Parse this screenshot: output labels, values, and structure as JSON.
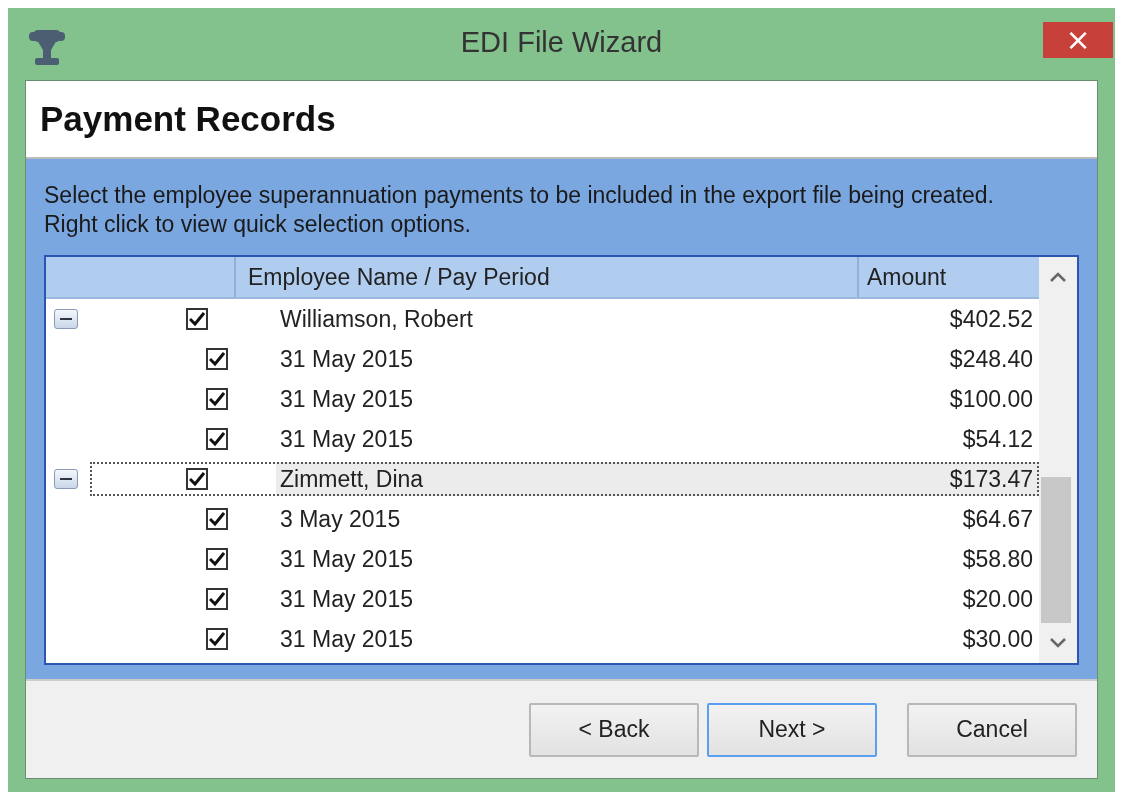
{
  "window": {
    "title": "EDI File Wizard",
    "close": "×"
  },
  "header": {
    "title": "Payment Records"
  },
  "instructions": "Select the employee superannuation payments to be included in the export file being created. Right click to view quick selection options.",
  "tree": {
    "columns": [
      "Employee Name / Pay Period",
      "Amount"
    ],
    "groups": [
      {
        "name": "Williamson, Robert",
        "amount": "$402.52",
        "expanded": true,
        "checked": true,
        "selected": false,
        "children": [
          {
            "name": "31 May 2015",
            "amount": "$248.40",
            "checked": true,
            "selected": false
          },
          {
            "name": "31 May 2015",
            "amount": "$100.00",
            "checked": true,
            "selected": false
          },
          {
            "name": "31 May 2015",
            "amount": "$54.12",
            "checked": true,
            "selected": false
          }
        ]
      },
      {
        "name": "Zimmett, Dina",
        "amount": "$173.47",
        "expanded": true,
        "checked": true,
        "selected": true,
        "children": [
          {
            "name": "3 May 2015",
            "amount": "$64.67",
            "checked": true,
            "selected": false
          },
          {
            "name": "31 May 2015",
            "amount": "$58.80",
            "checked": true,
            "selected": false
          },
          {
            "name": "31 May 2015",
            "amount": "$20.00",
            "checked": true,
            "selected": false
          },
          {
            "name": "31 May 2015",
            "amount": "$30.00",
            "checked": true,
            "selected": false
          }
        ]
      }
    ]
  },
  "buttons": [
    {
      "label": "< Back",
      "default": false
    },
    {
      "label": "Next >",
      "default": true
    },
    {
      "label": "Cancel",
      "default": false
    }
  ]
}
